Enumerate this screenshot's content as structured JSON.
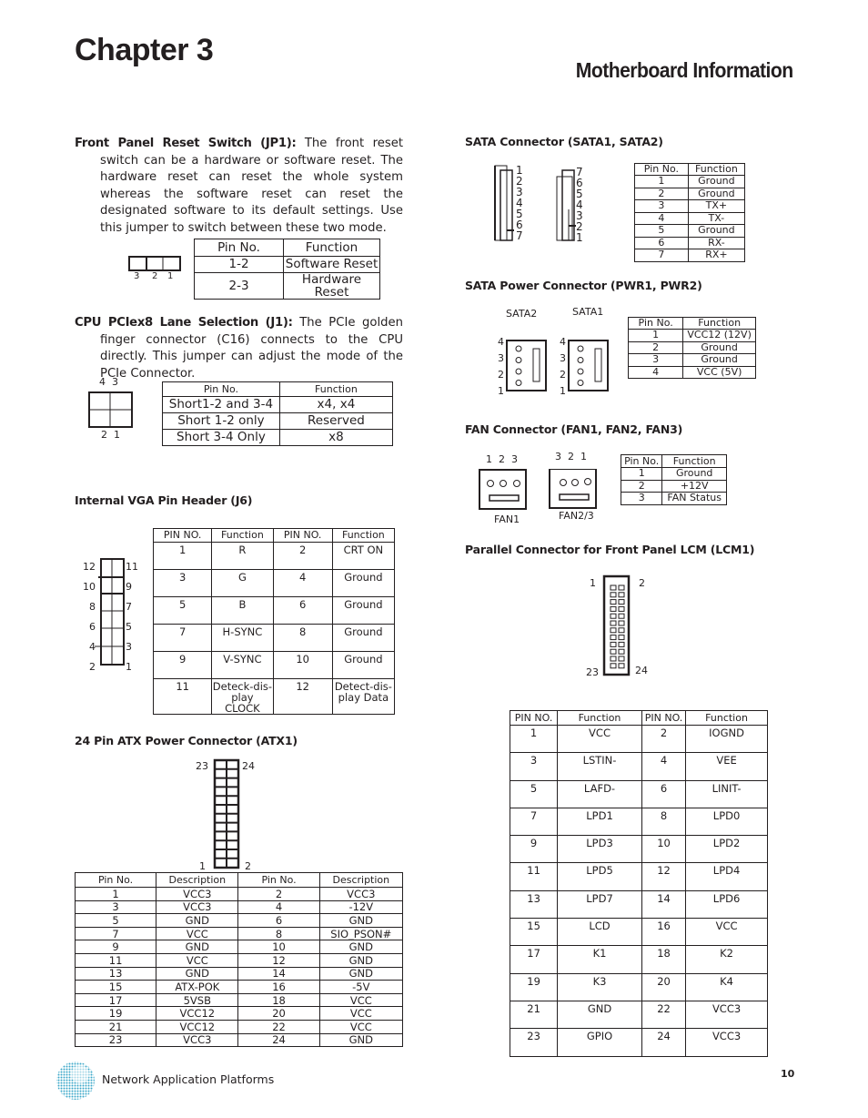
{
  "header": {
    "chapter": "Chapter 3",
    "section": "Motherboard Information"
  },
  "jp1": {
    "title": "Front Panel Reset Switch (JP1):",
    "text": " The front reset switch can be a hardware or software reset. The  hardware reset can reset the whole system whereas the software reset can reset the designated software to its default settings.  Use this jumper to switch between these two mode.",
    "pins": [
      "3",
      "2",
      "1"
    ],
    "table": {
      "headers": [
        "Pin No.",
        "Function"
      ],
      "rows": [
        [
          "1-2",
          "Software Reset"
        ],
        [
          "2-3",
          "Hardware Reset"
        ]
      ]
    }
  },
  "j1": {
    "title": "CPU PCIex8 Lane Selection (J1):",
    "text": " The PCIe golden finger connector (C16) connects to the CPU directly. This jumper can adjust the mode of the PCIe Connector.",
    "pins_top": "4  3",
    "pins_bottom": "2  1",
    "table": {
      "headers": [
        "Pin No.",
        "Function"
      ],
      "rows": [
        [
          "Short1-2 and 3-4",
          "x4, x4"
        ],
        [
          "Short 1-2 only",
          "Reserved"
        ],
        [
          "Short 3-4 Only",
          "x8"
        ]
      ]
    }
  },
  "vga": {
    "title": "Internal  VGA Pin Header (J6)",
    "pins_left": [
      "12",
      "10",
      "8",
      "6",
      "4",
      "2"
    ],
    "pins_right": [
      "11",
      "9",
      "7",
      "5",
      "3",
      "1"
    ],
    "table": {
      "headers": [
        "PIN NO.",
        "Function",
        "PIN NO.",
        "Function"
      ],
      "rows": [
        [
          "1",
          "R",
          "2",
          "CRT ON"
        ],
        [
          "3",
          "G",
          "4",
          "Ground"
        ],
        [
          "5",
          "B",
          "6",
          "Ground"
        ],
        [
          "7",
          "H-SYNC",
          "8",
          "Ground"
        ],
        [
          "9",
          "V-SYNC",
          "10",
          "Ground"
        ],
        [
          "11",
          "Deteck-dis-play CLOCK",
          "12",
          "Detect-dis-play Data"
        ]
      ]
    }
  },
  "atx": {
    "title": "24 Pin ATX Power Connector (ATX1)",
    "pin_labels": [
      "23",
      "24",
      "1",
      "2"
    ],
    "table": {
      "headers": [
        "Pin No.",
        "Description",
        "Pin No.",
        "Description"
      ],
      "rows": [
        [
          "1",
          "VCC3",
          "2",
          "VCC3"
        ],
        [
          "3",
          "VCC3",
          "4",
          "-12V"
        ],
        [
          "5",
          "GND",
          "6",
          "GND"
        ],
        [
          "7",
          "VCC",
          "8",
          "SIO_PSON#"
        ],
        [
          "9",
          "GND",
          "10",
          "GND"
        ],
        [
          "11",
          "VCC",
          "12",
          "GND"
        ],
        [
          "13",
          "GND",
          "14",
          "GND"
        ],
        [
          "15",
          "ATX-POK",
          "16",
          "-5V"
        ],
        [
          "17",
          "5VSB",
          "18",
          "VCC"
        ],
        [
          "19",
          "VCC12",
          "20",
          "VCC"
        ],
        [
          "21",
          "VCC12",
          "22",
          "VCC"
        ],
        [
          "23",
          "VCC3",
          "24",
          "GND"
        ]
      ]
    }
  },
  "sata": {
    "title": "SATA Connector (SATA1, SATA2)",
    "pins_a": [
      "1",
      "2",
      "3",
      "4",
      "5",
      "6",
      "7"
    ],
    "pins_b": [
      "7",
      "6",
      "5",
      "4",
      "3",
      "2",
      "1"
    ],
    "table": {
      "headers": [
        "Pin No.",
        "Function"
      ],
      "rows": [
        [
          "1",
          "Ground"
        ],
        [
          "2",
          "Ground"
        ],
        [
          "3",
          "TX+"
        ],
        [
          "4",
          "TX-"
        ],
        [
          "5",
          "Ground"
        ],
        [
          "6",
          "RX-"
        ],
        [
          "7",
          "RX+"
        ]
      ]
    }
  },
  "sata_power": {
    "title": "SATA Power Connector (PWR1, PWR2)",
    "labels": [
      "SATA2",
      "SATA1"
    ],
    "pins": [
      "4",
      "3",
      "2",
      "1"
    ],
    "table": {
      "headers": [
        "Pin No.",
        "Function"
      ],
      "rows": [
        [
          "1",
          "VCC12 (12V)"
        ],
        [
          "2",
          "Ground"
        ],
        [
          "3",
          "Ground"
        ],
        [
          "4",
          "VCC (5V)"
        ]
      ]
    }
  },
  "fan": {
    "title": "FAN Connector (FAN1, FAN2, FAN3)",
    "fan1_pins": "1  2  3",
    "fan23_pins": "3  2  1",
    "labels": [
      "FAN1",
      "FAN2/3"
    ],
    "table": {
      "headers": [
        "Pin No.",
        "Function"
      ],
      "rows": [
        [
          "1",
          "Ground"
        ],
        [
          "2",
          "+12V"
        ],
        [
          "3",
          "FAN Status"
        ]
      ]
    }
  },
  "lcm": {
    "title": "Parallel Connector for Front Panel LCM (LCM1)",
    "pin_labels": [
      "1",
      "2",
      "23",
      "24"
    ],
    "table": {
      "headers": [
        "PIN NO.",
        "Function",
        "PIN NO.",
        "Function"
      ],
      "rows": [
        [
          "1",
          "VCC",
          "2",
          "IOGND"
        ],
        [
          "3",
          "LSTIN-",
          "4",
          "VEE"
        ],
        [
          "5",
          "LAFD-",
          "6",
          "LINIT-"
        ],
        [
          "7",
          "LPD1",
          "8",
          "LPD0"
        ],
        [
          "9",
          "LPD3",
          "10",
          "LPD2"
        ],
        [
          "11",
          "LPD5",
          "12",
          "LPD4"
        ],
        [
          "13",
          "LPD7",
          "14",
          "LPD6"
        ],
        [
          "15",
          "LCD",
          "16",
          "VCC"
        ],
        [
          "17",
          "K1",
          "18",
          "K2"
        ],
        [
          "19",
          "K3",
          "20",
          "K4"
        ],
        [
          "21",
          "GND",
          "22",
          "VCC3"
        ],
        [
          "23",
          "GPIO",
          "24",
          "VCC3"
        ]
      ]
    }
  },
  "footer": {
    "text": "Network Application Platforms",
    "page": "10",
    "logo": "globe-logo"
  }
}
